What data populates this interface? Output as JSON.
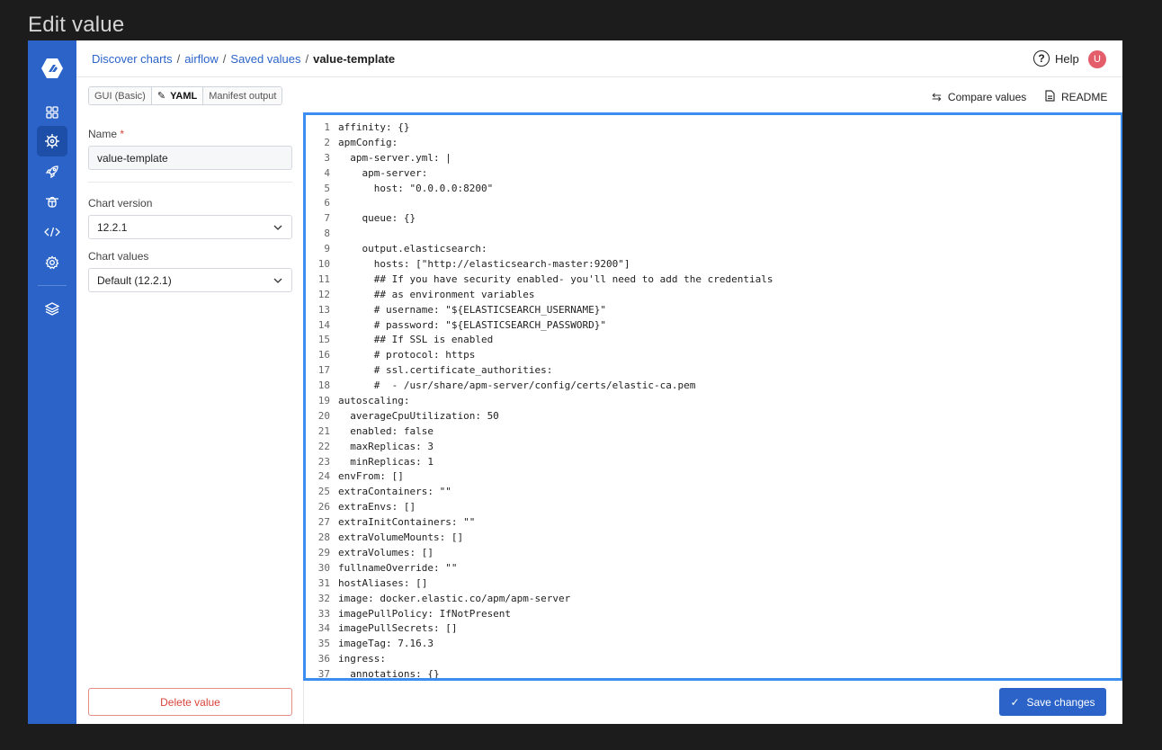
{
  "page_heading": "Edit value",
  "breadcrumb": {
    "items": [
      "Discover charts",
      "airflow",
      "Saved values"
    ],
    "current": "value-template",
    "separator": "/"
  },
  "header": {
    "help_label": "Help",
    "avatar_initial": "U"
  },
  "tabs": {
    "gui": "GUI (Basic)",
    "yaml": "YAML",
    "manifest": "Manifest output",
    "active": "YAML"
  },
  "actions": {
    "compare": "Compare values",
    "readme": "README"
  },
  "form": {
    "name_label": "Name",
    "name_required_mark": "*",
    "name_value": "value-template",
    "chart_version_label": "Chart version",
    "chart_version_value": "12.2.1",
    "chart_values_label": "Chart values",
    "chart_values_value": "Default (12.2.1)",
    "delete_label": "Delete value"
  },
  "save_label": "Save changes",
  "editor": {
    "lines": [
      "affinity: {}",
      "apmConfig:",
      "  apm-server.yml: |",
      "    apm-server:",
      "      host: \"0.0.0.0:8200\"",
      "",
      "    queue: {}",
      "",
      "    output.elasticsearch:",
      "      hosts: [\"http://elasticsearch-master:9200\"]",
      "      ## If you have security enabled- you'll need to add the credentials",
      "      ## as environment variables",
      "      # username: \"${ELASTICSEARCH_USERNAME}\"",
      "      # password: \"${ELASTICSEARCH_PASSWORD}\"",
      "      ## If SSL is enabled",
      "      # protocol: https",
      "      # ssl.certificate_authorities:",
      "      #  - /usr/share/apm-server/config/certs/elastic-ca.pem",
      "autoscaling:",
      "  averageCpuUtilization: 50",
      "  enabled: false",
      "  maxReplicas: 3",
      "  minReplicas: 1",
      "envFrom: []",
      "extraContainers: \"\"",
      "extraEnvs: []",
      "extraInitContainers: \"\"",
      "extraVolumeMounts: []",
      "extraVolumes: []",
      "fullnameOverride: \"\"",
      "hostAliases: []",
      "image: docker.elastic.co/apm/apm-server",
      "imagePullPolicy: IfNotPresent",
      "imagePullSecrets: []",
      "imageTag: 7.16.3",
      "ingress:",
      "  annotations: {}"
    ]
  },
  "colors": {
    "brand": "#2b63c9",
    "focus": "#3b8df0",
    "danger": "#d9443b",
    "avatar": "#e35d6a"
  },
  "nav_icons": [
    "dashboard-icon",
    "helm-wheel-icon",
    "rocket-icon",
    "bug-icon",
    "code-icon",
    "settings-icon",
    "layers-icon"
  ]
}
